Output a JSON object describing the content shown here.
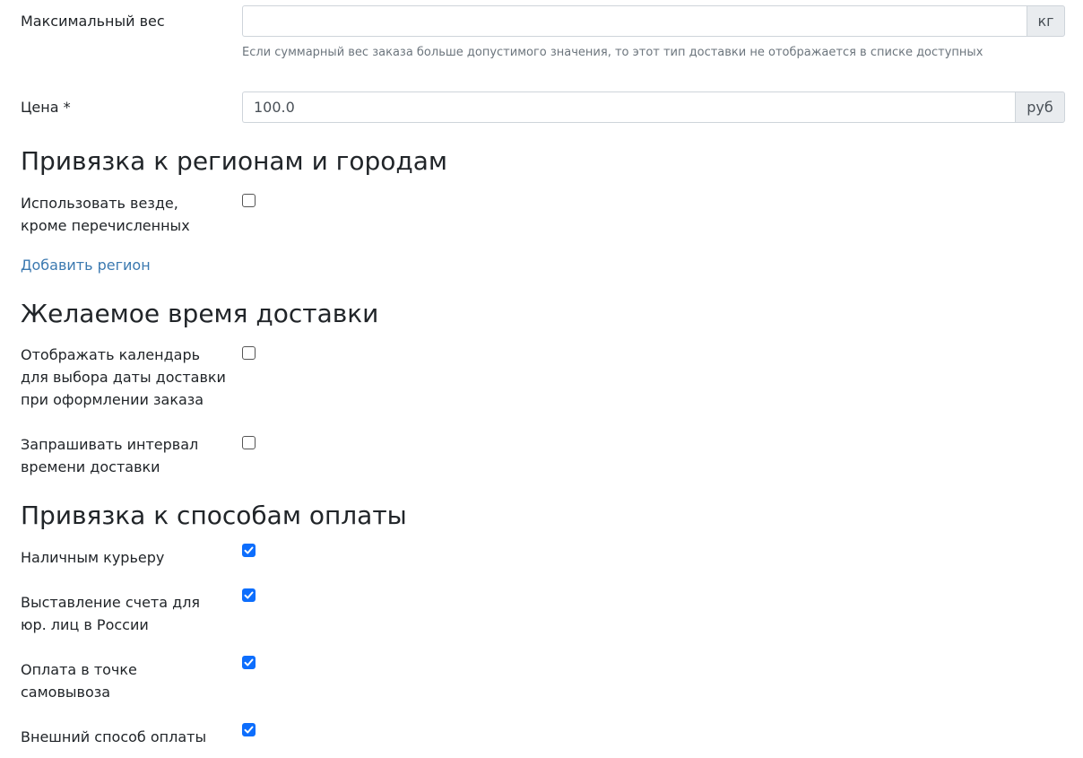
{
  "max_weight": {
    "label": "Максимальный вес",
    "value": "",
    "unit": "кг",
    "help": "Если суммарный вес заказа больше допустимого значения, то этот тип доставки не отображается в списке доступных"
  },
  "price": {
    "label": "Цена *",
    "value": "100.0",
    "unit": "руб"
  },
  "regions_section": {
    "title": "Привязка к регионам и городам",
    "use_everywhere_label_line1": "Использовать везде,",
    "use_everywhere_label_line2": "кроме перечисленных",
    "use_everywhere_checked": false,
    "add_region_link": "Добавить регион"
  },
  "delivery_time_section": {
    "title": "Желаемое время доставки",
    "calendar_label_line1": "Отображать календарь",
    "calendar_label_line2": "для выбора даты доставки",
    "calendar_label_line3": "при оформлении заказа",
    "calendar_checked": false,
    "interval_label_line1": "Запрашивать интервал",
    "interval_label_line2": "времени доставки",
    "interval_checked": false
  },
  "payment_section": {
    "title": "Привязка к способам оплаты",
    "methods": [
      {
        "label_line1": "Наличным курьеру",
        "label_line2": "",
        "checked": true
      },
      {
        "label_line1": "Выставление счета для",
        "label_line2": "юр. лиц в России",
        "checked": true
      },
      {
        "label_line1": "Оплата в точке",
        "label_line2": "самовывоза",
        "checked": true
      },
      {
        "label_line1": "Внешний способ оплаты",
        "label_line2": "",
        "checked": true
      }
    ]
  },
  "colors": {
    "accent": "#0d6efd",
    "link": "#3b79b0",
    "addon_bg": "#e9ecef"
  }
}
